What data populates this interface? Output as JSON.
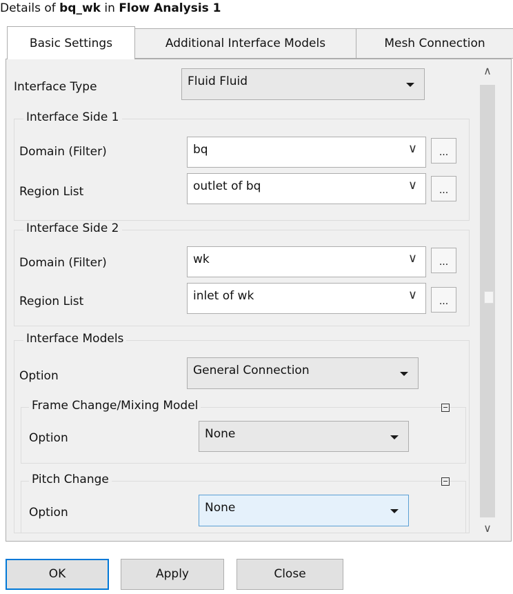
{
  "title": {
    "prefix": "Details of ",
    "object": "bq_wk",
    "mid": " in ",
    "analysis": "Flow Analysis 1"
  },
  "tabs": [
    {
      "label": "Basic Settings",
      "active": true
    },
    {
      "label": "Additional Interface Models",
      "active": false
    },
    {
      "label": "Mesh Connection",
      "active": false
    }
  ],
  "interface_type": {
    "label": "Interface Type",
    "value": "Fluid Fluid"
  },
  "side1": {
    "title": "Interface Side 1",
    "domain": {
      "label": "Domain (Filter)",
      "value": "bq"
    },
    "region": {
      "label": "Region List",
      "value": "outlet of bq"
    }
  },
  "side2": {
    "title": "Interface Side 2",
    "domain": {
      "label": "Domain (Filter)",
      "value": "wk"
    },
    "region": {
      "label": "Region List",
      "value": "inlet of wk"
    }
  },
  "models": {
    "title": "Interface Models",
    "option": {
      "label": "Option",
      "value": "General Connection"
    },
    "frame_change": {
      "title": "Frame Change/Mixing Model",
      "option_label": "Option",
      "option_value": "None"
    },
    "pitch_change": {
      "title": "Pitch Change",
      "option_label": "Option",
      "option_value": "None"
    }
  },
  "browse_label": "...",
  "buttons": {
    "ok": "OK",
    "apply": "Apply",
    "close": "Close"
  },
  "icons": {
    "dropdown": "chevron-down-icon",
    "collapse": "minus-box-icon",
    "scroll_up": "arrow-up-icon",
    "scroll_down": "arrow-down-icon"
  },
  "colors": {
    "focus_bg": "#e5f1fb",
    "focus_border": "#5a9fd4",
    "default_button_border": "#0078d7"
  }
}
